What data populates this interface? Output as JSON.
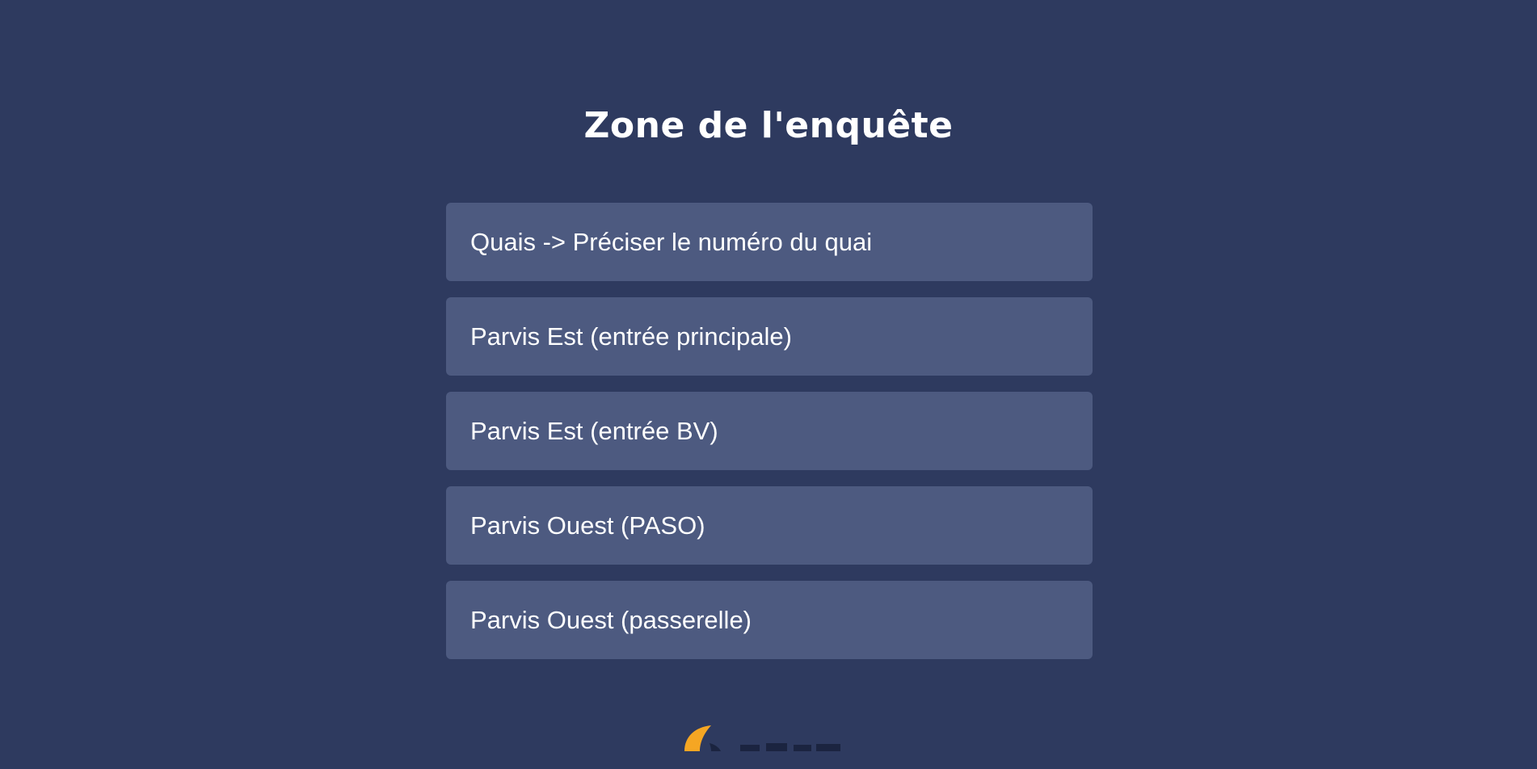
{
  "page": {
    "title": "Zone de l'enquête"
  },
  "options": [
    {
      "label": "Quais -> Préciser le numéro du quai"
    },
    {
      "label": "Parvis Est (entrée principale)"
    },
    {
      "label": "Parvis Est (entrée BV)"
    },
    {
      "label": "Parvis Ouest (PASO)"
    },
    {
      "label": "Parvis Ouest (passerelle)"
    }
  ],
  "colors": {
    "background": "#2e3a5f",
    "option_background": "#4d5a80",
    "text": "#ffffff",
    "logo_accent": "#f5a623"
  },
  "logo": {
    "icon": "brand-logo-icon"
  }
}
